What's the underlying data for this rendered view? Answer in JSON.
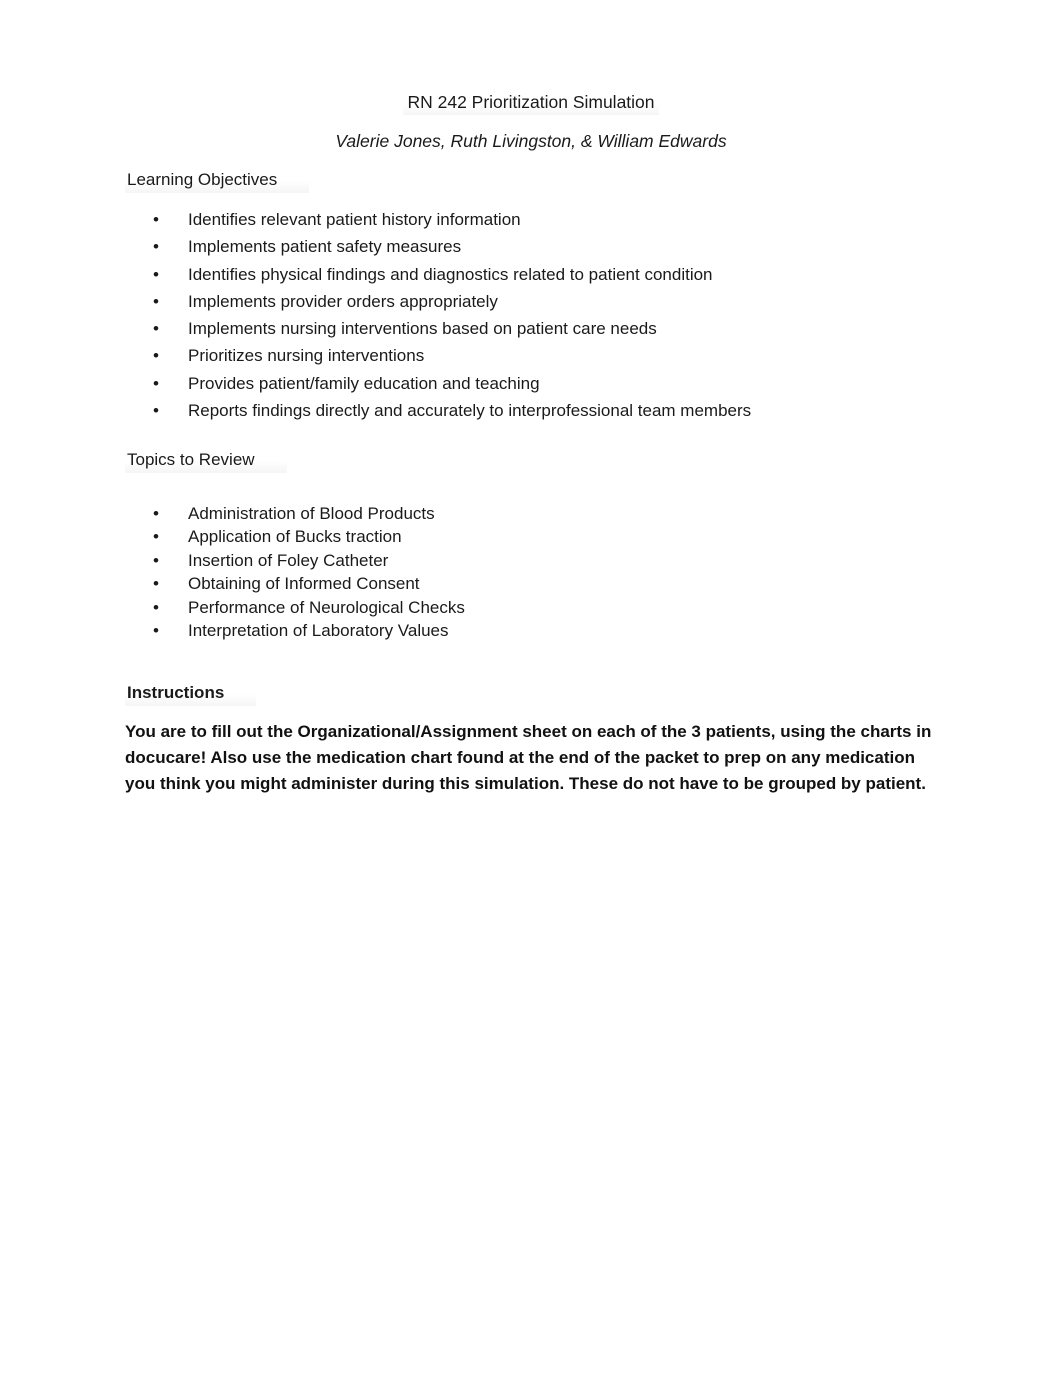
{
  "document": {
    "title": "RN 242 Prioritization Simulation",
    "authors": "Valerie Jones, Ruth Livingston, & William Edwards"
  },
  "sections": {
    "objectives": {
      "heading": "Learning Objectives",
      "items": [
        "Identifies relevant patient history information",
        "Implements patient safety measures",
        "Identifies physical findings and diagnostics related to patient condition",
        "Implements provider orders appropriately",
        "Implements nursing interventions based on patient care needs",
        "Prioritizes nursing interventions",
        "Provides patient/family education and teaching",
        "Reports findings directly and accurately to interprofessional team members"
      ]
    },
    "topics": {
      "heading": "Topics to Review",
      "items": [
        "Administration of Blood Products",
        "Application of Bucks traction",
        "Insertion of Foley Catheter",
        "Obtaining of Informed Consent",
        "Performance of Neurological Checks",
        "Interpretation of Laboratory Values"
      ]
    },
    "instructions": {
      "heading": "Instructions",
      "body": "You are to fill out the Organizational/Assignment sheet on each of the 3 patients, using the charts in docucare! Also use the medication chart found at the end of the packet to prep on any medication you think you might administer during this simulation. These do not have to be grouped by patient."
    }
  },
  "bullet_glyph": "•"
}
